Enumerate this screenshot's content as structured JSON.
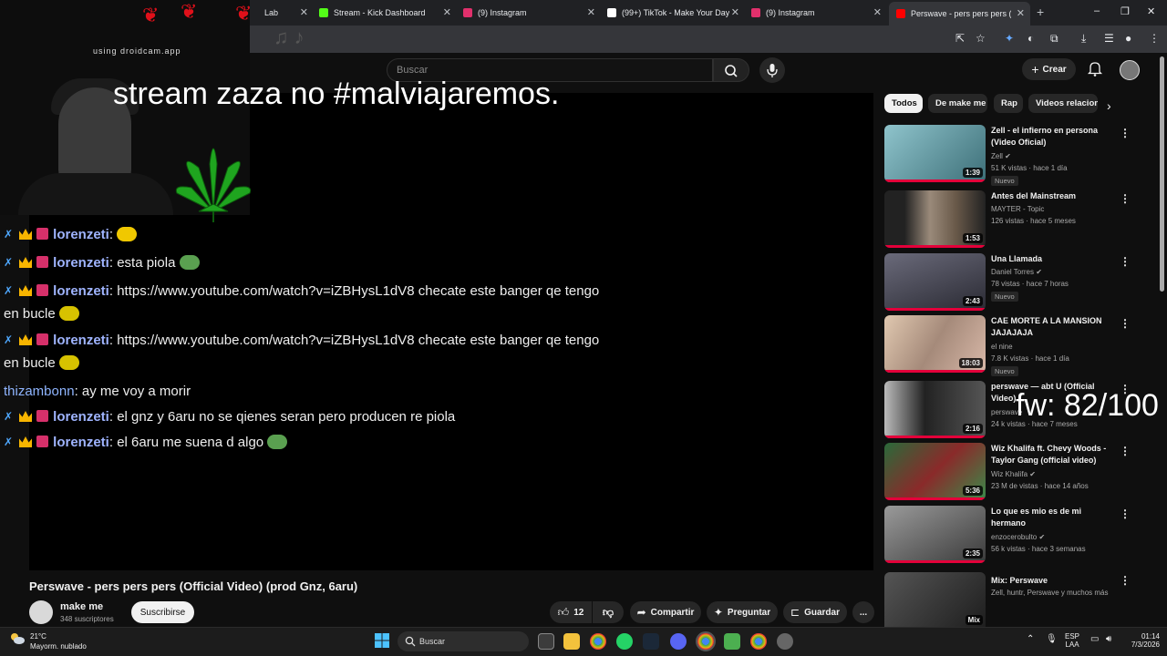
{
  "browser": {
    "tabs": [
      {
        "label": "Lab",
        "color": "#6b6b6b"
      },
      {
        "label": "Stream - Kick Dashboard",
        "color": "#53fc18"
      },
      {
        "label": "(9) Instagram",
        "color": "#e1306c"
      },
      {
        "label": "(99+) TikTok - Make Your Day",
        "color": "#ffffff"
      },
      {
        "label": "(9) Instagram",
        "color": "#e1306c"
      },
      {
        "label": "Perswave - pers pers pers (",
        "color": "#ff0000"
      }
    ],
    "new_tab": "+",
    "window_controls": [
      "–",
      "❐",
      "✕"
    ]
  },
  "youtube": {
    "search_placeholder": "Buscar",
    "create_label": "Crear"
  },
  "stream_overlay": {
    "watermark": "using droidcam.app",
    "title": "stream zaza no #malviajaremos.",
    "counter": "fw: 82/100",
    "chat": [
      {
        "user": "lorenzeti",
        "badges": true,
        "text": ":",
        "emote": "#f0c800"
      },
      {
        "user": "lorenzeti",
        "badges": true,
        "text": ": esta piola",
        "emote": "#5aa050"
      },
      {
        "user": "lorenzeti",
        "badges": true,
        "text": ": https://www.youtube.com/watch?v=iZBHysL1dV8 checate este banger qe tengo",
        "emote": null
      },
      {
        "user": "",
        "badges": false,
        "text": "en bucle",
        "emote": "#d7c200"
      },
      {
        "user": "lorenzeti",
        "badges": true,
        "text": ": https://www.youtube.com/watch?v=iZBHysL1dV8 checate este banger qe tengo",
        "emote": null
      },
      {
        "user": "",
        "badges": false,
        "text": "en bucle",
        "emote": "#d7c200"
      },
      {
        "user": "thizambonn",
        "badges": false,
        "text": ": ay me voy a morir",
        "emote": null
      },
      {
        "user": "lorenzeti",
        "badges": true,
        "text": ": el gnz y 6aru no se qienes seran pero producen re piola",
        "emote": null
      },
      {
        "user": "lorenzeti",
        "badges": true,
        "text": ": el 6aru me suena d algo",
        "emote": "#5aa050"
      }
    ]
  },
  "video": {
    "title": "Perswave - pers pers pers (Official Video) (prod Gnz, 6aru)",
    "channel": "make me",
    "subscribers": "348 suscriptores",
    "subscribe_label": "Suscribirse",
    "likes": "12",
    "share_label": "Compartir",
    "ask_label": "Preguntar",
    "save_label": "Guardar",
    "more_label": "..."
  },
  "chips": [
    "Todos",
    "De make me",
    "Rap",
    "Videos relacionados"
  ],
  "recommendations": [
    {
      "title": "Zell - el infierno en persona (Video Oficial)",
      "channel": "Zell",
      "verified": true,
      "meta": "51 K vistas · hace 1 día",
      "badge": "Nuevo",
      "duration": "1:39",
      "thumb": "#5f9aa5"
    },
    {
      "title": "Antes del Mainstream",
      "channel": "MAYTER - Topic",
      "verified": false,
      "meta": "126 vistas · hace 5 meses",
      "badge": "",
      "duration": "1:53",
      "thumb": "#8a7a6a"
    },
    {
      "title": "Una Llamada",
      "channel": "Daniel Torres",
      "verified": true,
      "meta": "78 vistas · hace 7 horas",
      "badge": "Nuevo",
      "duration": "2:43",
      "thumb": "#4a4a52"
    },
    {
      "title": "CAE MORTE A LA MANSION JAJAJAJA",
      "channel": "el nine",
      "verified": false,
      "meta": "7.8 K vistas · hace 1 día",
      "badge": "Nuevo",
      "duration": "18:03",
      "thumb": "#c9a98a"
    },
    {
      "title": "perswave — abt U (Official Video)",
      "channel": "perswave",
      "verified": false,
      "meta": "24 k vistas · hace 7 meses",
      "badge": "",
      "duration": "2:16",
      "thumb": "#3a3a3a"
    },
    {
      "title": "Wiz Khalifa ft. Chevy Woods - Taylor Gang (official video)",
      "channel": "Wiz Khalifa",
      "verified": true,
      "meta": "23 M de vistas · hace 14 años",
      "badge": "",
      "duration": "5:36",
      "thumb": "#7a3a2a"
    },
    {
      "title": "Lo que es mio es de mi hermano",
      "channel": "enzocerobulto",
      "verified": true,
      "meta": "56 k vistas · hace 3 semanas",
      "badge": "",
      "duration": "2:35",
      "thumb": "#5a5a5a"
    },
    {
      "title": "Mix: Perswave",
      "channel": "Zell, huntr, Perswave y muchos más",
      "verified": false,
      "meta": "",
      "badge": "",
      "duration": "Mix",
      "thumb": "#2e2e2e"
    }
  ],
  "taskbar": {
    "temperature": "21°C",
    "weather": "Mayorm. nublado",
    "search_placeholder": "Buscar",
    "language_1": "ESP",
    "language_2": "LAA",
    "time": "01:14",
    "date": "7/3/2026"
  }
}
